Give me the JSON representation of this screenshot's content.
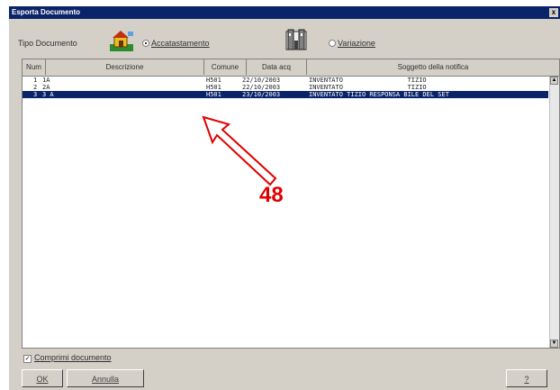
{
  "window": {
    "title": "Esporta Documento",
    "close_glyph": "x"
  },
  "tipo": {
    "label": "Tipo Documento",
    "option1": {
      "label": "Accatastamento",
      "selected": true,
      "icon": "house-icon"
    },
    "option2": {
      "label": "Variazione",
      "selected": false,
      "icon": "building-icon"
    }
  },
  "table": {
    "columns": [
      "Num",
      "Descrizione",
      "Comune",
      "Data acq",
      "Soggetto della notifica"
    ],
    "rows": [
      {
        "num": "1",
        "descr": "1A",
        "comune": "H501",
        "data": "22/10/2003",
        "soggetto": "INVENTATO                 TIZIO",
        "selected": false
      },
      {
        "num": "2",
        "descr": "2A",
        "comune": "H501",
        "data": "22/10/2003",
        "soggetto": "INVENTATO                 TIZIO",
        "selected": false
      },
      {
        "num": "3",
        "descr": "3 A",
        "comune": "H501",
        "data": "23/10/2003",
        "soggetto": "INVENTATO TIZIO RESPONSA BILE DEL SET",
        "selected": true
      }
    ]
  },
  "compress": {
    "label": "Comprimi documento",
    "checked": true
  },
  "buttons": {
    "ok": "OK",
    "cancel": "Annulla",
    "help": "?"
  },
  "annotation": {
    "number": "48",
    "color": "#e00000"
  }
}
